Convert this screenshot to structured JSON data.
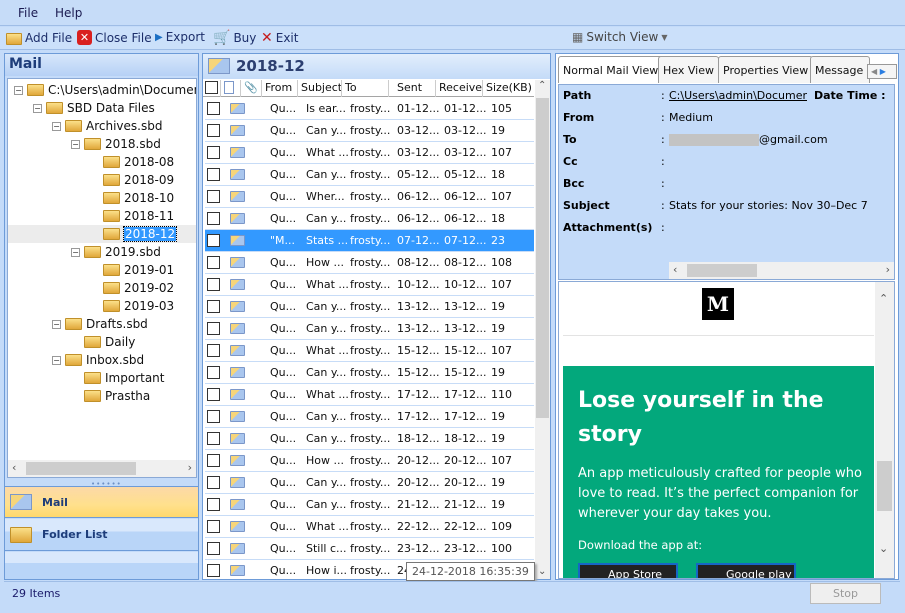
{
  "menu": [
    "File",
    "Help"
  ],
  "toolbar": {
    "add_file": "Add File",
    "close_file": "Close File",
    "export": "Export",
    "buy": "Buy",
    "exit": "Exit",
    "switch_view": "Switch View"
  },
  "left": {
    "title": "Mail",
    "tree": [
      {
        "label": "C:\\Users\\admin\\Documents",
        "level": 0,
        "expander": true,
        "icon": "open-folder-icon"
      },
      {
        "label": "SBD Data Files",
        "level": 1,
        "expander": true,
        "icon": "data-files-icon"
      },
      {
        "label": "Archives.sbd",
        "level": 2,
        "expander": true
      },
      {
        "label": "2018.sbd",
        "level": 3,
        "expander": true
      },
      {
        "label": "2018-08",
        "level": 4
      },
      {
        "label": "2018-09",
        "level": 4
      },
      {
        "label": "2018-10",
        "level": 4
      },
      {
        "label": "2018-11",
        "level": 4
      },
      {
        "label": "2018-12",
        "level": 4,
        "selected": true
      },
      {
        "label": "2019.sbd",
        "level": 3,
        "expander": true
      },
      {
        "label": "2019-01",
        "level": 4
      },
      {
        "label": "2019-02",
        "level": 4
      },
      {
        "label": "2019-03",
        "level": 4
      },
      {
        "label": "Drafts.sbd",
        "level": 2,
        "expander": true
      },
      {
        "label": "Daily",
        "level": 3
      },
      {
        "label": "Inbox.sbd",
        "level": 2,
        "expander": true
      },
      {
        "label": "Important",
        "level": 3
      },
      {
        "label": "Prastha",
        "level": 3
      }
    ],
    "nav": {
      "mail": "Mail",
      "folder_list": "Folder List"
    }
  },
  "status": {
    "items": "29 Items",
    "stop": "Stop"
  },
  "list": {
    "folder": "2018-12",
    "columns": [
      "From",
      "Subject",
      "To",
      "Sent",
      "Receive",
      "Size(KB)"
    ],
    "rows": [
      [
        "Qu...",
        "Is ear...",
        "frosty...",
        "01-12...",
        "01-12...",
        "105"
      ],
      [
        "Qu...",
        "Can y...",
        "frosty...",
        "03-12...",
        "03-12...",
        "19"
      ],
      [
        "Qu...",
        "What ...",
        "frosty...",
        "03-12...",
        "03-12...",
        "107"
      ],
      [
        "Qu...",
        "Can y...",
        "frosty...",
        "05-12...",
        "05-12...",
        "18"
      ],
      [
        "Qu...",
        "Wher...",
        "frosty...",
        "06-12...",
        "06-12...",
        "107"
      ],
      [
        "Qu...",
        "Can y...",
        "frosty...",
        "06-12...",
        "06-12...",
        "18"
      ],
      [
        "\"M...",
        "Stats ...",
        "frosty...",
        "07-12...",
        "07-12...",
        "23"
      ],
      [
        "Qu...",
        "How ...",
        "frosty...",
        "08-12...",
        "08-12...",
        "108"
      ],
      [
        "Qu...",
        "What ...",
        "frosty...",
        "10-12...",
        "10-12...",
        "107"
      ],
      [
        "Qu...",
        "Can y...",
        "frosty...",
        "13-12...",
        "13-12...",
        "19"
      ],
      [
        "Qu...",
        "Can y...",
        "frosty...",
        "13-12...",
        "13-12...",
        "19"
      ],
      [
        "Qu...",
        "What ...",
        "frosty...",
        "15-12...",
        "15-12...",
        "107"
      ],
      [
        "Qu...",
        "Can y...",
        "frosty...",
        "15-12...",
        "15-12...",
        "19"
      ],
      [
        "Qu...",
        "What ...",
        "frosty...",
        "17-12...",
        "17-12...",
        "110"
      ],
      [
        "Qu...",
        "Can y...",
        "frosty...",
        "17-12...",
        "17-12...",
        "19"
      ],
      [
        "Qu...",
        "Can y...",
        "frosty...",
        "18-12...",
        "18-12...",
        "19"
      ],
      [
        "Qu...",
        "How ...",
        "frosty...",
        "20-12...",
        "20-12...",
        "107"
      ],
      [
        "Qu...",
        "Can y...",
        "frosty...",
        "20-12...",
        "20-12...",
        "19"
      ],
      [
        "Qu...",
        "Can y...",
        "frosty...",
        "21-12...",
        "21-12...",
        "19"
      ],
      [
        "Qu...",
        "What ...",
        "frosty...",
        "22-12...",
        "22-12...",
        "109"
      ],
      [
        "Qu...",
        "Still c...",
        "frosty...",
        "23-12...",
        "23-12...",
        "100"
      ],
      [
        "Qu...",
        "How i...",
        "frosty...",
        "24-12...",
        "24-12...",
        ""
      ]
    ],
    "selected_index": 6,
    "tooltip": "24-12-2018 16:35:39"
  },
  "viewer": {
    "tabs": [
      "Normal Mail View",
      "Hex View",
      "Properties View",
      "Message"
    ],
    "fields": [
      {
        "label": "Path",
        "value": "C:\\Users\\admin\\Documents\\"
      },
      {
        "label": "From",
        "value": "Medium"
      },
      {
        "label": "To",
        "value": "@gmail.com"
      },
      {
        "label": "Cc",
        "value": ""
      },
      {
        "label": "Bcc",
        "value": ""
      },
      {
        "label": "Subject",
        "value": "Stats for your stories: Nov 30–Dec 7"
      },
      {
        "label": "Attachment(s)",
        "value": ""
      }
    ],
    "date_time_label": "Date Time",
    "logo": "M",
    "headline": "Lose yourself in the story",
    "body_text": "An app meticulously crafted for people who love to read. It’s the perfect companion for wherever your day takes you.",
    "download": "Download the app at:",
    "app_store": "App Store",
    "google_play": "Google play",
    "accent": "#03a87c"
  }
}
